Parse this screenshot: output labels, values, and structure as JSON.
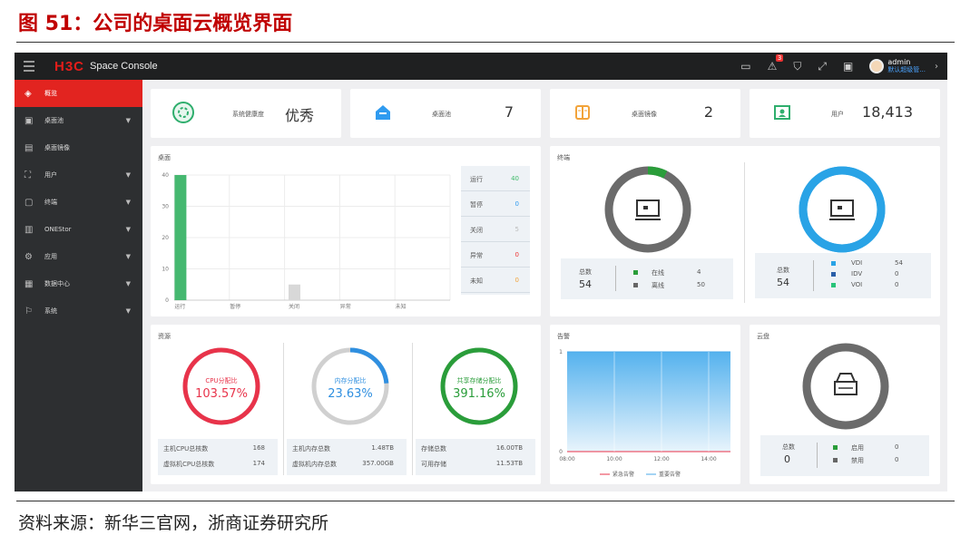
{
  "figure": {
    "title": "图 51：公司的桌面云概览界面",
    "source": "资料来源：新华三官网，浙商证券研究所"
  },
  "topbar": {
    "brand": "H3C",
    "product": "Space Console",
    "alert_badge": "3",
    "user_name": "admin",
    "user_role": "默认超级管..."
  },
  "sidebar": {
    "items": [
      {
        "label": "概览",
        "icon": "layers-icon",
        "active": true
      },
      {
        "label": "桌面池",
        "icon": "desktop-pool-icon",
        "caret": true
      },
      {
        "label": "桌面镜像",
        "icon": "image-icon",
        "caret": false
      },
      {
        "label": "用户",
        "icon": "user-icon",
        "caret": true
      },
      {
        "label": "终端",
        "icon": "terminal-icon",
        "caret": true
      },
      {
        "label": "ONEStor",
        "icon": "storage-icon",
        "caret": true
      },
      {
        "label": "应用",
        "icon": "app-icon",
        "caret": true
      },
      {
        "label": "数据中心",
        "icon": "datacenter-icon",
        "caret": true
      },
      {
        "label": "系统",
        "icon": "system-icon",
        "caret": true
      }
    ]
  },
  "stats": [
    {
      "label": "系统健康度",
      "value": "优秀",
      "color": "#2fae6d",
      "icon": "health-icon"
    },
    {
      "label": "桌面池",
      "value": "7",
      "color": "#2f9bf0",
      "icon": "home-icon"
    },
    {
      "label": "桌面镜像",
      "value": "2",
      "color": "#f2a33a",
      "icon": "book-icon"
    },
    {
      "label": "用户",
      "value": "18,413",
      "color": "#2fae6d",
      "icon": "user-card-icon"
    }
  ],
  "desktop_card": {
    "title": "桌面",
    "legend": [
      {
        "label": "运行",
        "value": "40",
        "color": "#3fbb6a"
      },
      {
        "label": "暂停",
        "value": "0",
        "color": "#2f9bf0"
      },
      {
        "label": "关闭",
        "value": "5",
        "color": "#bbbbbb"
      },
      {
        "label": "异常",
        "value": "0",
        "color": "#e33"
      },
      {
        "label": "未知",
        "value": "0",
        "color": "#f2a33a"
      }
    ]
  },
  "chart_data": {
    "type": "bar",
    "categories": [
      "运行",
      "暂停",
      "关闭",
      "异常",
      "未知"
    ],
    "values": [
      40,
      0,
      5,
      0,
      0
    ],
    "colors": [
      "#45b870",
      "#2f9bf0",
      "#d8d8d8",
      "#e33",
      "#f2a33a"
    ],
    "ylim": [
      0,
      40
    ],
    "yticks": [
      "0",
      "10",
      "20",
      "30",
      "40"
    ],
    "grid": true
  },
  "terminal_card": {
    "title": "终端",
    "left": {
      "total_label": "总数",
      "total": "54",
      "rows": [
        {
          "label": "在线",
          "value": "4",
          "color": "#2a9d3a"
        },
        {
          "label": "离线",
          "value": "50",
          "color": "#666"
        }
      ],
      "online_fraction": 0.074
    },
    "right": {
      "total_label": "总数",
      "total": "54",
      "rows": [
        {
          "label": "VDI",
          "value": "54",
          "color": "#29a3e6"
        },
        {
          "label": "IDV",
          "value": "0",
          "color": "#2a5fa8"
        },
        {
          "label": "VOI",
          "value": "0",
          "color": "#29c47a"
        }
      ]
    }
  },
  "resource_card": {
    "title": "资源",
    "gauges": [
      {
        "label": "CPU分配比",
        "value": "103.57%",
        "color": "#e8334a",
        "fraction": 1.0,
        "rows": [
          {
            "label": "主机CPU总核数",
            "value": "168"
          },
          {
            "label": "虚拟机CPU总核数",
            "value": "174"
          }
        ]
      },
      {
        "label": "内存分配比",
        "value": "23.63%",
        "color": "#2f8fe0",
        "fraction": 0.2363,
        "rows": [
          {
            "label": "主机内存总数",
            "value": "1.48TB"
          },
          {
            "label": "虚拟机内存总数",
            "value": "357.00GB"
          }
        ]
      },
      {
        "label": "共享存储分配比",
        "value": "391.16%",
        "color": "#2a9d3a",
        "fraction": 1.0,
        "rows": [
          {
            "label": "存储总数",
            "value": "16.00TB"
          },
          {
            "label": "可用存储",
            "value": "11.53TB"
          }
        ]
      }
    ]
  },
  "alarm_card": {
    "title": "告警",
    "y_top": "1",
    "y_bottom": "0",
    "xticks": [
      "08:00",
      "10:00",
      "12:00",
      "14:00"
    ],
    "legend": [
      {
        "label": "紧急告警",
        "color": "#e8334a"
      },
      {
        "label": "重要告警",
        "color": "#4aa8ea"
      }
    ]
  },
  "cloud_card": {
    "title": "云盘",
    "total_label": "总数",
    "total": "0",
    "rows": [
      {
        "label": "启用",
        "value": "0",
        "color": "#2a9d3a"
      },
      {
        "label": "禁用",
        "value": "0",
        "color": "#666"
      }
    ]
  }
}
